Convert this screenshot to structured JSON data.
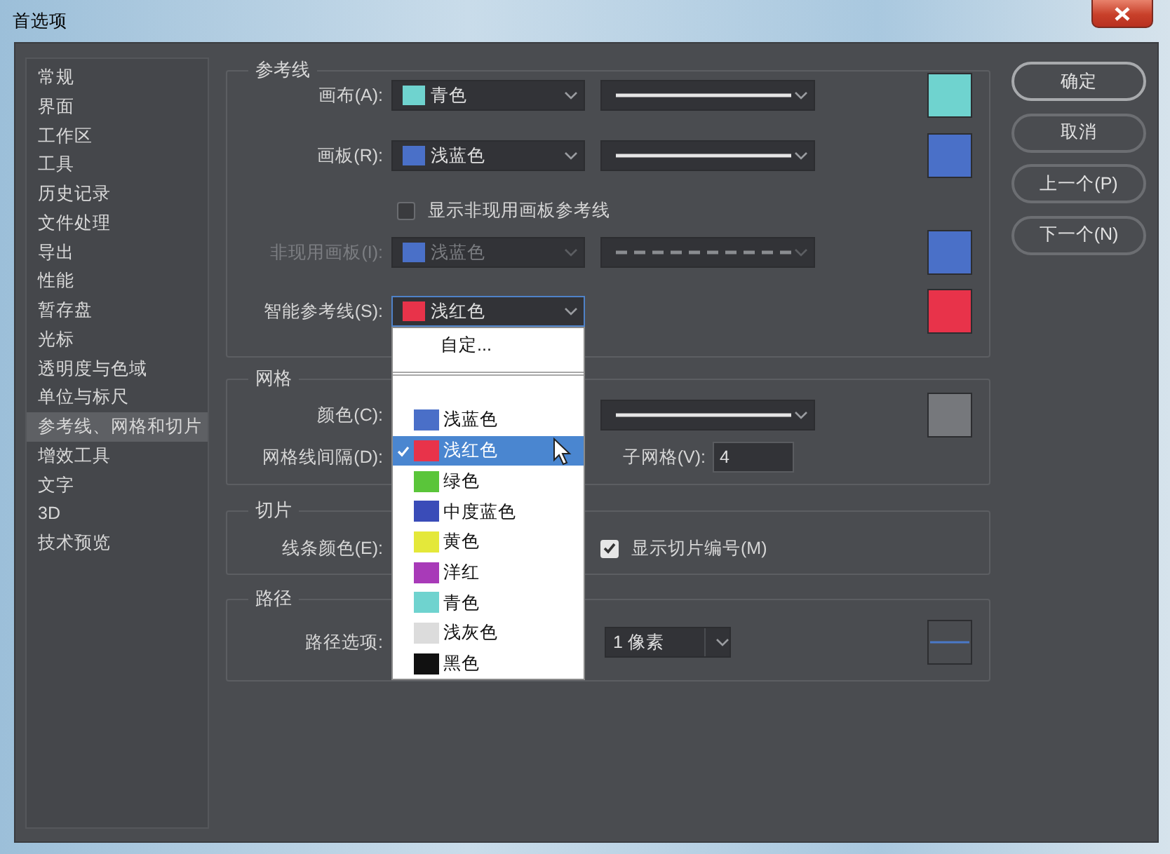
{
  "window": {
    "title": "首选项"
  },
  "sidebar": {
    "items": [
      {
        "label": "常规",
        "selected": false
      },
      {
        "label": "界面",
        "selected": false
      },
      {
        "label": "工作区",
        "selected": false
      },
      {
        "label": "工具",
        "selected": false
      },
      {
        "label": "历史记录",
        "selected": false
      },
      {
        "label": "文件处理",
        "selected": false
      },
      {
        "label": "导出",
        "selected": false
      },
      {
        "label": "性能",
        "selected": false
      },
      {
        "label": "暂存盘",
        "selected": false
      },
      {
        "label": "光标",
        "selected": false
      },
      {
        "label": "透明度与色域",
        "selected": false
      },
      {
        "label": "单位与标尺",
        "selected": false
      },
      {
        "label": "参考线、网格和切片",
        "selected": true
      },
      {
        "label": "增效工具",
        "selected": false
      },
      {
        "label": "文字",
        "selected": false
      },
      {
        "label": "3D",
        "selected": false
      },
      {
        "label": "技术预览",
        "selected": false
      }
    ]
  },
  "groups": [
    {
      "title": "参考线",
      "rows": [
        {
          "kind": "color",
          "label": "画布(A):",
          "color_name": "青色",
          "color": "#6fd3cf",
          "dashed": false,
          "disabled": false
        },
        {
          "kind": "color",
          "label": "画板(R):",
          "color_name": "浅蓝色",
          "color": "#4a70c8",
          "dashed": false,
          "disabled": false
        },
        {
          "kind": "checkbox",
          "label": "显示非现用画板参考线",
          "checked": false
        },
        {
          "kind": "color",
          "label": "非现用画板(I):",
          "color_name": "浅蓝色",
          "color": "#4a70c8",
          "dashed": true,
          "disabled": true
        },
        {
          "kind": "color",
          "label": "智能参考线(S):",
          "color_name": "浅红色",
          "color": "#e8334a",
          "disabled": false,
          "open": true
        }
      ]
    },
    {
      "title": "网格",
      "rows": [
        {
          "kind": "color",
          "label": "颜色(C):",
          "color": "#76787c",
          "dashed": false,
          "disabled": false
        },
        {
          "kind": "spacing",
          "label": "网格线间隔(D):",
          "sub_label": "子网格(V):",
          "sub_value": "4"
        }
      ]
    },
    {
      "title": "切片",
      "rows": [
        {
          "kind": "slice",
          "label": "线条颜色(E):",
          "check_label": "显示切片编号(M)",
          "checked": true
        }
      ]
    },
    {
      "title": "路径",
      "rows": [
        {
          "kind": "path",
          "label": "路径选项:",
          "size": "1 像素"
        }
      ]
    }
  ],
  "color_menu": {
    "items": [
      {
        "kind": "command",
        "label": "自定..."
      },
      {
        "kind": "separator"
      },
      {
        "kind": "color",
        "label": "浅蓝色",
        "color": "#4a6fc8",
        "selected": false
      },
      {
        "kind": "color",
        "label": "浅红色",
        "color": "#e8334a",
        "selected": true
      },
      {
        "kind": "color",
        "label": "绿色",
        "color": "#5ac53a",
        "selected": false
      },
      {
        "kind": "color",
        "label": "中度蓝色",
        "color": "#3a4cb8",
        "selected": false
      },
      {
        "kind": "color",
        "label": "黄色",
        "color": "#e4e83a",
        "selected": false
      },
      {
        "kind": "color",
        "label": "洋红",
        "color": "#a83ab8",
        "selected": false
      },
      {
        "kind": "color",
        "label": "青色",
        "color": "#6fd3cf",
        "selected": false
      },
      {
        "kind": "color",
        "label": "浅灰色",
        "color": "#dcdcdc",
        "selected": false
      },
      {
        "kind": "color",
        "label": "黑色",
        "color": "#111111",
        "selected": false
      }
    ]
  },
  "buttons": [
    {
      "label": "确定",
      "default": true
    },
    {
      "label": "取消",
      "default": false
    },
    {
      "label": "上一个(P)",
      "default": false
    },
    {
      "label": "下一个(N)",
      "default": false
    }
  ]
}
